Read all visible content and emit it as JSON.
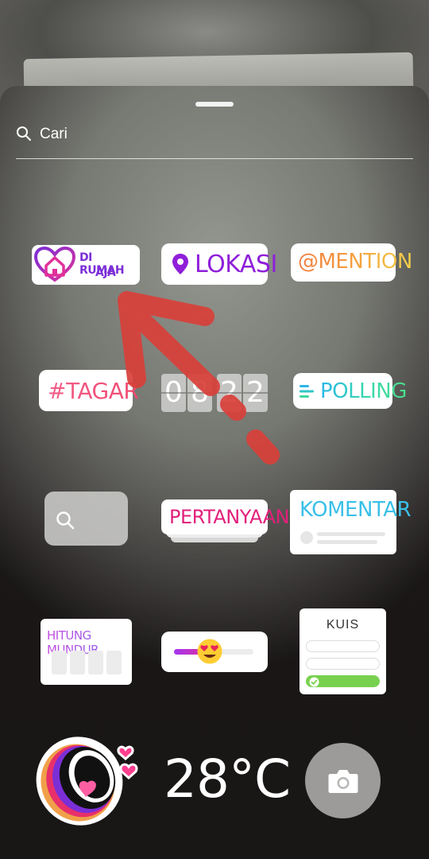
{
  "search": {
    "placeholder": "Cari",
    "icon": "search-icon"
  },
  "stickers": {
    "di_rumah_aja": {
      "line1": "DI RUMAH",
      "line2": "AJA",
      "icon": "heart-house-icon",
      "colors": [
        "#7b2fd6",
        "#e0309a"
      ]
    },
    "lokasi": {
      "label": "LOKASI",
      "icon": "location-pin-icon",
      "color": "#8f1fd9"
    },
    "mention": {
      "label": "@MENTION"
    },
    "tagar": {
      "label": "#TAGAR"
    },
    "time": {
      "digits": [
        "0",
        "8",
        "2",
        "2"
      ]
    },
    "polling": {
      "label": "POLLING",
      "icon": "poll-lines-icon"
    },
    "search_sticker": {
      "icon": "search-icon"
    },
    "pertanyaan": {
      "label": "PERTANYAAN",
      "color": "#e2207c"
    },
    "komentar": {
      "label": "KOMENTAR",
      "color": "#3ac0e8"
    },
    "hitung_mundur": {
      "label": "HITUNG MUNDUR"
    },
    "emoji_slider": {
      "emoji": "heart-eyes-emoji",
      "value": 0.44
    },
    "kuis": {
      "label": "KUIS",
      "options": 3,
      "correct_index": 2,
      "correct_color": "#78d14e"
    },
    "mouth": {
      "icon": "screaming-mouth-hearts-icon"
    },
    "temperature": {
      "label": "28°C"
    },
    "camera": {
      "icon": "camera-icon"
    }
  },
  "annotation": {
    "type": "red dashed arrow pointing to DI RUMAH AJA sticker",
    "color": "#d9403a"
  }
}
